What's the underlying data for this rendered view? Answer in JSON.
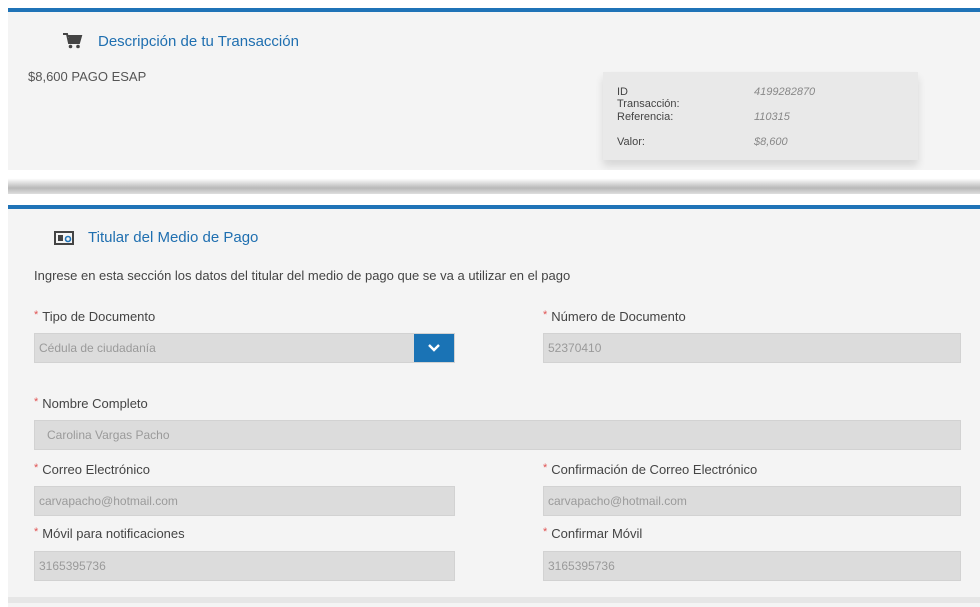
{
  "transaction": {
    "section_title": "Descripción de tu Transacción",
    "description": "$8,600 PAGO ESAP",
    "details": [
      {
        "label": "ID Transacción:",
        "value": "4199282870"
      },
      {
        "label": "Referencia:",
        "value": "110315"
      },
      {
        "label": "Valor:",
        "value": "$8,600"
      }
    ]
  },
  "holder": {
    "section_title": "Titular del Medio de Pago",
    "intro": "Ingrese en esta sección los datos del titular del medio de pago que se va a utilizar en el pago",
    "required_marker": "*",
    "fields": {
      "doc_type": {
        "label": "Tipo de Documento",
        "value": "Cédula de ciudadanía"
      },
      "doc_number": {
        "label": "Número de Documento",
        "value": "52370410"
      },
      "full_name": {
        "label": "Nombre Completo",
        "value": "Carolina Vargas Pacho"
      },
      "email": {
        "label": "Correo Electrónico",
        "value": "carvapacho@hotmail.com"
      },
      "email_confirm": {
        "label": "Confirmación de Correo Electrónico",
        "value": "carvapacho@hotmail.com"
      },
      "mobile": {
        "label": "Móvil para notificaciones",
        "value": "3165395736"
      },
      "mobile_confirm": {
        "label": "Confirmar Móvil",
        "value": "3165395736"
      }
    }
  },
  "colors": {
    "accent": "#1f73b7",
    "required": "#e05252",
    "panel_bg": "#f4f4f4",
    "input_bg": "#dcdcdc"
  },
  "icons": {
    "transaction": "shopping-cart-icon",
    "holder": "id-card-icon",
    "select": "chevron-down-icon"
  }
}
